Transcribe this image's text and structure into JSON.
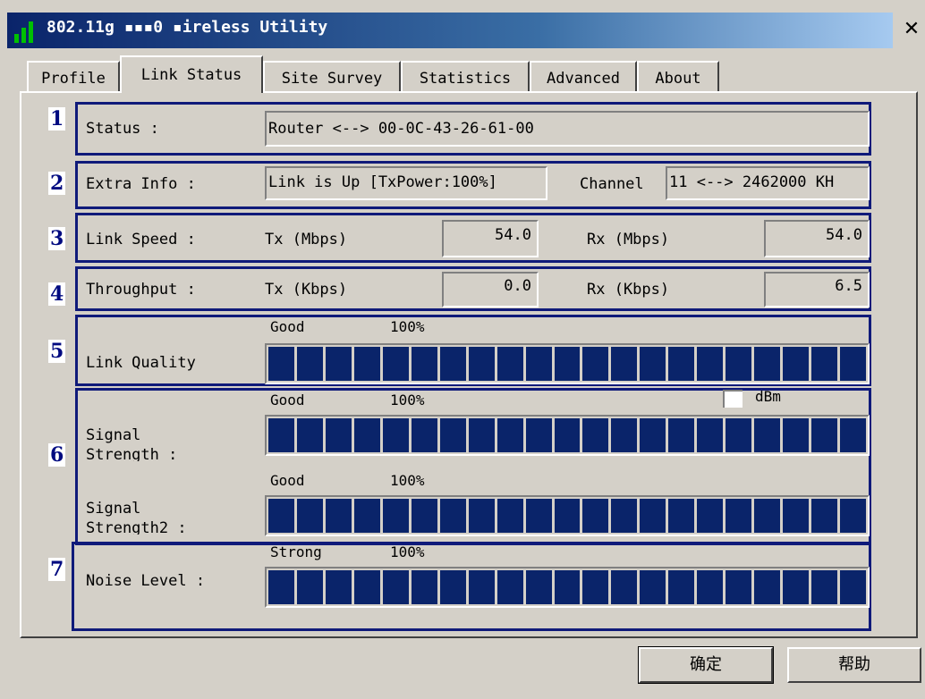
{
  "window": {
    "title": "802.11g ▪▪▪0 ▪ireless Utility",
    "close_label": "✕"
  },
  "tabs": [
    {
      "label": "Profile"
    },
    {
      "label": "Link Status"
    },
    {
      "label": "Site Survey"
    },
    {
      "label": "Statistics"
    },
    {
      "label": "Advanced"
    },
    {
      "label": "About"
    }
  ],
  "active_tab": "Link Status",
  "groups": {
    "status": {
      "number": "1",
      "label": "Status :",
      "value": "Router <--> 00-0C-43-26-61-00"
    },
    "extra": {
      "number": "2",
      "label": "Extra Info :",
      "value": "Link is Up [TxPower:100%]",
      "channel_label": "Channel",
      "channel_value": "11 <--> 2462000 KH"
    },
    "speed": {
      "number": "3",
      "label": "Link Speed :",
      "tx_label": "Tx (Mbps)",
      "tx_value": "54.0",
      "rx_label": "Rx (Mbps)",
      "rx_value": "54.0"
    },
    "throughput": {
      "number": "4",
      "label": "Throughput :",
      "tx_label": "Tx (Kbps)",
      "tx_value": "0.0",
      "rx_label": "Rx (Kbps)",
      "rx_value": "6.5"
    },
    "quality": {
      "number": "5",
      "label": "Link Quality",
      "level": "Good",
      "percent": "100%",
      "fill": 1.0
    },
    "signal": {
      "number": "6",
      "dbm_label": "dBm",
      "strength1": {
        "label": "Signal\nStrength :",
        "level": "Good",
        "percent": "100%",
        "fill": 1.0
      },
      "strength2": {
        "label": "Signal\nStrength2 :",
        "level": "Good",
        "percent": "100%",
        "fill": 1.0
      }
    },
    "noise": {
      "number": "7",
      "label": "Noise Level :",
      "level": "Strong",
      "percent": "100%",
      "fill": 1.0
    }
  },
  "buttons": {
    "ok": "确定",
    "help": "帮助"
  },
  "colors": {
    "bar_fill": "#0a246a",
    "group_border": "#0f1a7a"
  }
}
